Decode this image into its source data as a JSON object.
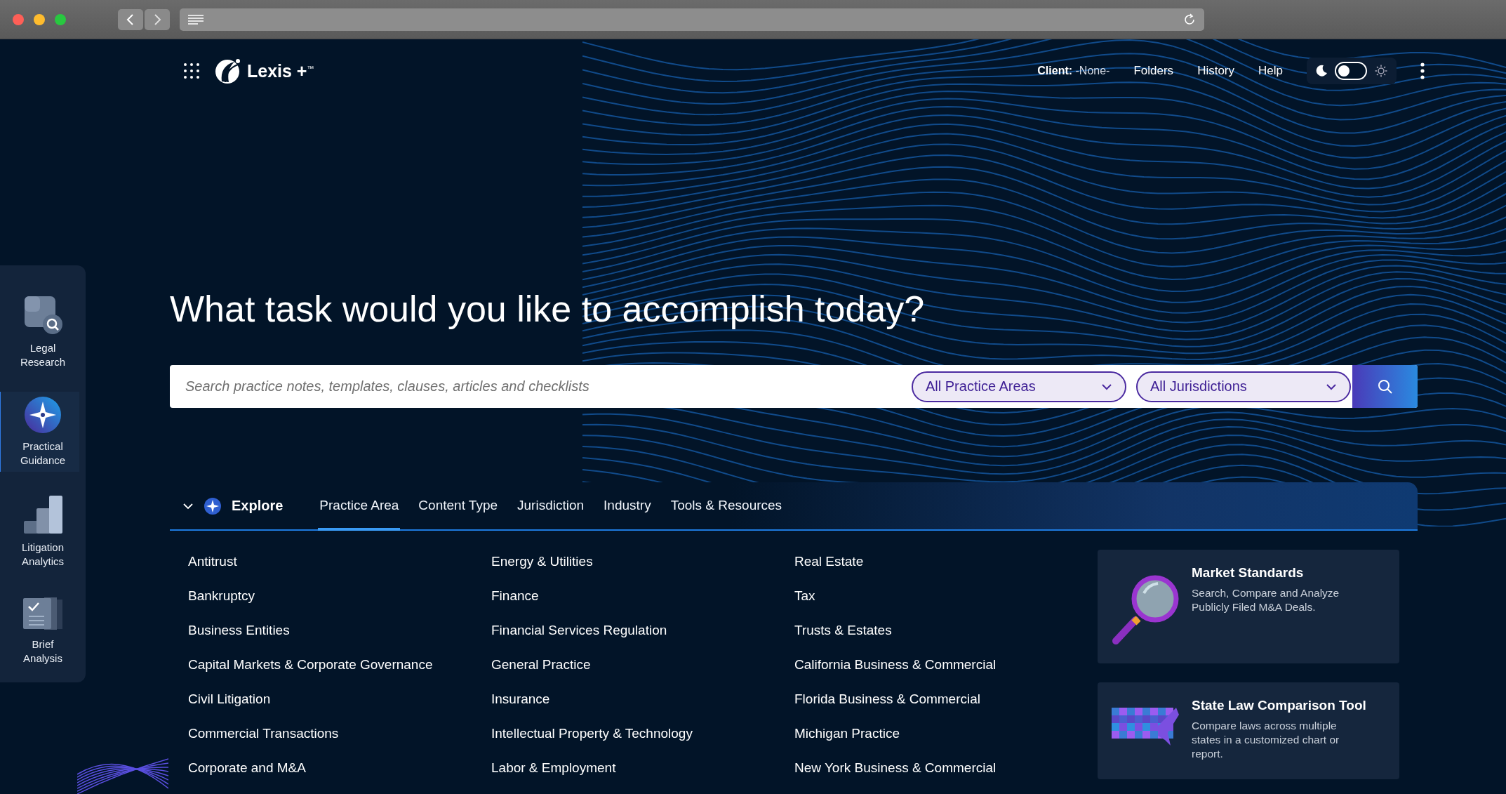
{
  "header": {
    "logo": "Lexis +$^{™}$",
    "client_label": "Client:",
    "client_value": "-None-",
    "links": [
      "Folders",
      "History",
      "Help"
    ],
    "theme_toggle": {
      "on": false
    }
  },
  "sidebar": {
    "items": [
      {
        "label": "Legal Research",
        "kind": "research",
        "selected": false
      },
      {
        "label": "Practical Guidance",
        "kind": "guidance",
        "selected": true
      },
      {
        "label": "Litigation Analytics",
        "kind": "analytics",
        "selected": false
      },
      {
        "label": "Brief Analysis",
        "kind": "brief",
        "selected": false
      }
    ]
  },
  "headline": "What task would you like to accomplish today?",
  "search": {
    "placeholder": "Search practice notes, templates, clauses, articles and checklists",
    "filters": [
      "All Practice Areas",
      "All Jurisdictions"
    ]
  },
  "explore": {
    "label": "Explore",
    "expanded": true,
    "tabs": [
      {
        "label": "Practice Area",
        "selected": true
      },
      {
        "label": "Content Type",
        "selected": false
      },
      {
        "label": "Jurisdiction",
        "selected": false
      },
      {
        "label": "Industry",
        "selected": false
      },
      {
        "label": "Tools & Resources",
        "selected": false
      }
    ]
  },
  "practice_areas": {
    "columns": [
      [
        "Antitrust",
        "Bankruptcy",
        "Business Entities",
        "Capital Markets & Corporate Governance",
        "Civil Litigation",
        "Commercial Transactions",
        "Corporate and M&A"
      ],
      [
        "Energy & Utilities",
        "Finance",
        "Financial Services Regulation",
        "General Practice",
        "Insurance",
        "Intellectual Property & Technology",
        "Labor & Employment"
      ],
      [
        "Real Estate",
        "Tax",
        "Trusts & Estates",
        "California Business & Commercial",
        "Florida Business & Commercial",
        "Michigan Practice",
        "New York Business & Commercial"
      ]
    ]
  },
  "cards": [
    {
      "kind": "magnifier",
      "title": "Market Standards",
      "description": "Search, Compare and Analyze Publicly Filed M&A Deals."
    },
    {
      "kind": "map",
      "title": "State Law Comparison Tool",
      "description": "Compare laws across multiple states in a customized chart or report."
    }
  ]
}
